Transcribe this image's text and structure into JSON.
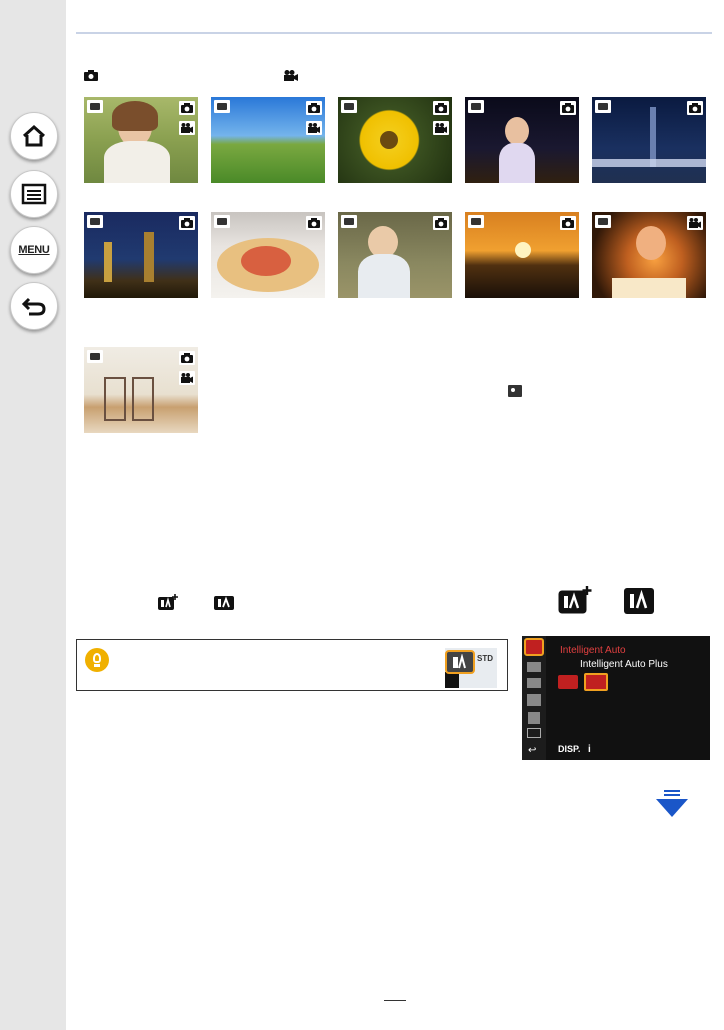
{
  "sidebar": {
    "buttons": [
      {
        "name": "home-button",
        "icon": "home-icon"
      },
      {
        "name": "contents-button",
        "icon": "list-icon"
      },
      {
        "name": "menu-button",
        "icon": "menu-icon",
        "label": "MENU"
      },
      {
        "name": "back-button",
        "icon": "back-arrow-icon"
      }
    ]
  },
  "lcd": {
    "title": "Intelligent Auto",
    "option": "Intelligent Auto Plus",
    "disp": "DISP."
  },
  "colors": {
    "sidebar_bg": "#e6e6e6",
    "accent_blue": "#1a56c8",
    "highlight_orange": "#f0a020",
    "lcd_red": "#e04040"
  }
}
